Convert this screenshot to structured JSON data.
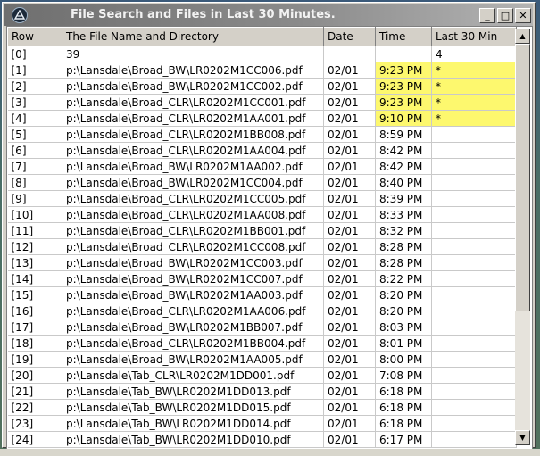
{
  "window": {
    "title": "File Search and Files in Last 30 Minutes."
  },
  "title_buttons": {
    "minimize": "_",
    "maximize": "□",
    "close": "✕"
  },
  "columns": [
    "Row",
    "The File Name and Directory",
    "Date",
    "Time",
    "Last 30 Min"
  ],
  "highlight_color": "#fdf86e",
  "rows": [
    {
      "row": "[0]",
      "file": "39",
      "date": "",
      "time": "",
      "recent": "4"
    },
    {
      "row": "[1]",
      "file": "p:\\Lansdale\\Broad_BW\\LR0202M1CC006.pdf",
      "date": "02/01",
      "time": "9:23 PM",
      "recent": "*"
    },
    {
      "row": "[2]",
      "file": "p:\\Lansdale\\Broad_BW\\LR0202M1CC002.pdf",
      "date": "02/01",
      "time": "9:23 PM",
      "recent": "*"
    },
    {
      "row": "[3]",
      "file": "p:\\Lansdale\\Broad_CLR\\LR0202M1CC001.pdf",
      "date": "02/01",
      "time": "9:23 PM",
      "recent": "*"
    },
    {
      "row": "[4]",
      "file": "p:\\Lansdale\\Broad_CLR\\LR0202M1AA001.pdf",
      "date": "02/01",
      "time": "9:10 PM",
      "recent": "*"
    },
    {
      "row": "[5]",
      "file": "p:\\Lansdale\\Broad_CLR\\LR0202M1BB008.pdf",
      "date": "02/01",
      "time": "8:59 PM",
      "recent": ""
    },
    {
      "row": "[6]",
      "file": "p:\\Lansdale\\Broad_CLR\\LR0202M1AA004.pdf",
      "date": "02/01",
      "time": "8:42 PM",
      "recent": ""
    },
    {
      "row": "[7]",
      "file": "p:\\Lansdale\\Broad_BW\\LR0202M1AA002.pdf",
      "date": "02/01",
      "time": "8:42 PM",
      "recent": ""
    },
    {
      "row": "[8]",
      "file": "p:\\Lansdale\\Broad_BW\\LR0202M1CC004.pdf",
      "date": "02/01",
      "time": "8:40 PM",
      "recent": ""
    },
    {
      "row": "[9]",
      "file": "p:\\Lansdale\\Broad_CLR\\LR0202M1CC005.pdf",
      "date": "02/01",
      "time": "8:39 PM",
      "recent": ""
    },
    {
      "row": "[10]",
      "file": "p:\\Lansdale\\Broad_CLR\\LR0202M1AA008.pdf",
      "date": "02/01",
      "time": "8:33 PM",
      "recent": ""
    },
    {
      "row": "[11]",
      "file": "p:\\Lansdale\\Broad_CLR\\LR0202M1BB001.pdf",
      "date": "02/01",
      "time": "8:32 PM",
      "recent": ""
    },
    {
      "row": "[12]",
      "file": "p:\\Lansdale\\Broad_CLR\\LR0202M1CC008.pdf",
      "date": "02/01",
      "time": "8:28 PM",
      "recent": ""
    },
    {
      "row": "[13]",
      "file": "p:\\Lansdale\\Broad_BW\\LR0202M1CC003.pdf",
      "date": "02/01",
      "time": "8:28 PM",
      "recent": ""
    },
    {
      "row": "[14]",
      "file": "p:\\Lansdale\\Broad_BW\\LR0202M1CC007.pdf",
      "date": "02/01",
      "time": "8:22 PM",
      "recent": ""
    },
    {
      "row": "[15]",
      "file": "p:\\Lansdale\\Broad_BW\\LR0202M1AA003.pdf",
      "date": "02/01",
      "time": "8:20 PM",
      "recent": ""
    },
    {
      "row": "[16]",
      "file": "p:\\Lansdale\\Broad_CLR\\LR0202M1AA006.pdf",
      "date": "02/01",
      "time": "8:20 PM",
      "recent": ""
    },
    {
      "row": "[17]",
      "file": "p:\\Lansdale\\Broad_BW\\LR0202M1BB007.pdf",
      "date": "02/01",
      "time": "8:03 PM",
      "recent": ""
    },
    {
      "row": "[18]",
      "file": "p:\\Lansdale\\Broad_CLR\\LR0202M1BB004.pdf",
      "date": "02/01",
      "time": "8:01 PM",
      "recent": ""
    },
    {
      "row": "[19]",
      "file": "p:\\Lansdale\\Broad_BW\\LR0202M1AA005.pdf",
      "date": "02/01",
      "time": "8:00 PM",
      "recent": ""
    },
    {
      "row": "[20]",
      "file": "p:\\Lansdale\\Tab_CLR\\LR0202M1DD001.pdf",
      "date": "02/01",
      "time": "7:08 PM",
      "recent": ""
    },
    {
      "row": "[21]",
      "file": "p:\\Lansdale\\Tab_BW\\LR0202M1DD013.pdf",
      "date": "02/01",
      "time": "6:18 PM",
      "recent": ""
    },
    {
      "row": "[22]",
      "file": "p:\\Lansdale\\Tab_BW\\LR0202M1DD015.pdf",
      "date": "02/01",
      "time": "6:18 PM",
      "recent": ""
    },
    {
      "row": "[23]",
      "file": "p:\\Lansdale\\Tab_BW\\LR0202M1DD014.pdf",
      "date": "02/01",
      "time": "6:18 PM",
      "recent": ""
    },
    {
      "row": "[24]",
      "file": "p:\\Lansdale\\Tab_BW\\LR0202M1DD010.pdf",
      "date": "02/01",
      "time": "6:17 PM",
      "recent": ""
    }
  ],
  "scrollbar": {
    "up": "▲",
    "down": "▼"
  }
}
